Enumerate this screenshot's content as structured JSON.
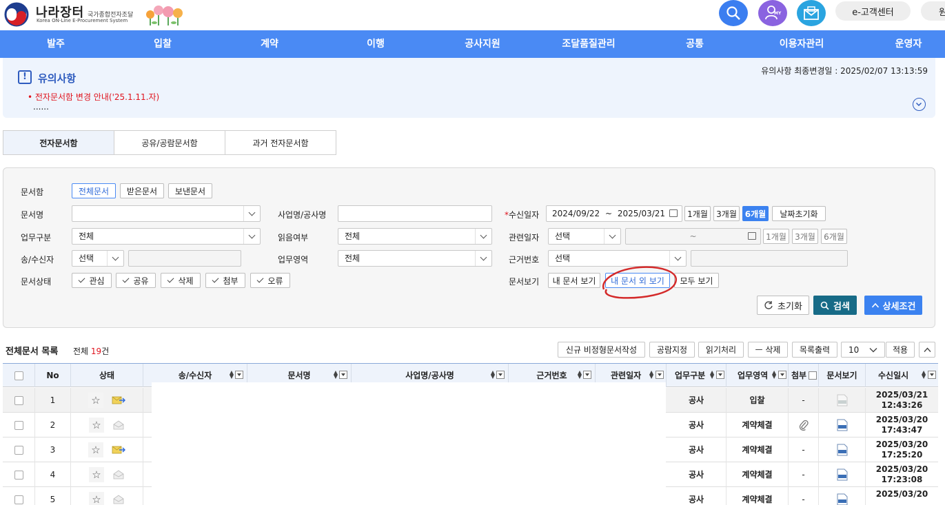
{
  "header": {
    "logo_title": "나라장터",
    "logo_small": "국가종합전자조달",
    "logo_sub": "Korea ON-Line E-Procurement System",
    "search_icon": "search-icon",
    "my_label": "MY",
    "mail_icon": "mail-icon",
    "customer_center": "e-고객센터",
    "extra_pill": "원"
  },
  "nav": [
    "발주",
    "입찰",
    "계약",
    "이행",
    "공사지원",
    "조달품질관리",
    "공통",
    "이용자관리",
    "운영자"
  ],
  "notice": {
    "title": "유의사항",
    "last_updated": "유의사항 최종변경일 : 2025/02/07 13:13:59",
    "link": "• 전자문서함 변경 안내('25.1.11.자)",
    "dots": "......"
  },
  "tabs": [
    "전자문서함",
    "공유/공람문서함",
    "과거 전자문서함"
  ],
  "search": {
    "box_label": "문서함",
    "box_options": [
      "전체문서",
      "받은문서",
      "보낸문서"
    ],
    "docname_label": "문서명",
    "docname_value": "",
    "project_label": "사업명/공사명",
    "project_value": "",
    "recv_date_req": "*",
    "recv_date_label": "수신일자",
    "recv_date_from": "2024/09/22",
    "recv_date_sep": "~",
    "recv_date_to": "2025/03/21",
    "period_1": "1개월",
    "period_3": "3개월",
    "period_6": "6개월",
    "date_reset": "날짜초기화",
    "biz_type_label": "업무구분",
    "biz_type_value": "전체",
    "read_label": "읽음여부",
    "read_value": "전체",
    "rel_date_label": "관련일자",
    "rel_date_value": "선택",
    "rel_date_sep": "~",
    "sender_label": "송/수신자",
    "sender_value": "선택",
    "area_label": "업무영역",
    "area_value": "전체",
    "basis_label": "근거번호",
    "basis_value": "선택",
    "status_label": "문서상태",
    "status_checks": [
      "관심",
      "공유",
      "삭제",
      "첨부",
      "오류"
    ],
    "view_label": "문서보기",
    "view_options": [
      "내 문서 보기",
      "내 문서 외 보기",
      "모두 보기"
    ],
    "reset_btn": "초기화",
    "search_btn": "검색",
    "detail_btn": "상세조건"
  },
  "list": {
    "title": "전체문서 목록",
    "count_prefix": "전체 ",
    "count": "19",
    "count_suffix": "건",
    "buttons": [
      "신규 비정형문서작성",
      "공람지정",
      "읽기처리",
      "ㅡ 삭제",
      "목록출력"
    ],
    "page_size": "10",
    "apply": "적용",
    "collapse_icon": "chevron-up-icon"
  },
  "table": {
    "columns": [
      "No",
      "상태",
      "송/수신자",
      "문서명",
      "사업명/공사명",
      "근거번호",
      "관련일자",
      "업무구분",
      "업무영역",
      "첨부",
      "문서보기",
      "수신일시"
    ],
    "rows": [
      {
        "no": "1",
        "biz": "공사",
        "area": "입찰",
        "attach": "-",
        "date": "2025/03/21",
        "time": "12:43:26",
        "status_icon": "envelope-arrow-icon"
      },
      {
        "no": "2",
        "biz": "공사",
        "area": "계약체결",
        "attach": "paperclip",
        "date": "2025/03/20",
        "time": "17:43:47",
        "status_icon": "envelope-open-icon"
      },
      {
        "no": "3",
        "biz": "공사",
        "area": "계약체결",
        "attach": "-",
        "date": "2025/03/20",
        "time": "17:25:20",
        "status_icon": "envelope-arrow-icon"
      },
      {
        "no": "4",
        "biz": "공사",
        "area": "계약체결",
        "attach": "-",
        "date": "2025/03/20",
        "time": "17:23:08",
        "status_icon": "envelope-open-icon"
      },
      {
        "no": "5",
        "biz": "공사",
        "area": "계약체결",
        "attach": "-",
        "date": "2025/03/20",
        "time": "",
        "status_icon": "envelope-open-icon"
      }
    ]
  }
}
